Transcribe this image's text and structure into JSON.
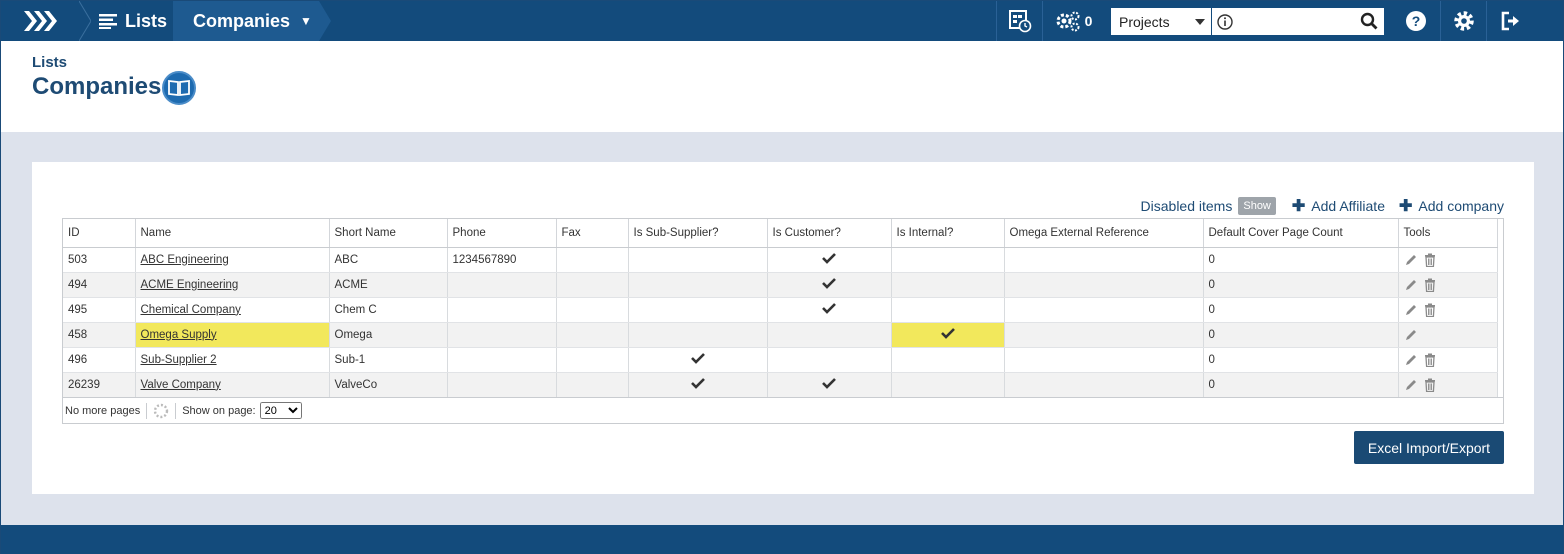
{
  "nav": {
    "lists_label": "Lists",
    "companies_label": "Companies",
    "notifications_count": "0",
    "project_select": "Projects"
  },
  "header": {
    "breadcrumb": "Lists",
    "title": "Companies"
  },
  "actions": {
    "disabled_label": "Disabled items",
    "show_badge": "Show",
    "add_affiliate": "Add Affiliate",
    "add_company": "Add company"
  },
  "table": {
    "columns": [
      "ID",
      "Name",
      "Short Name",
      "Phone",
      "Fax",
      "Is Sub-Supplier?",
      "Is Customer?",
      "Is Internal?",
      "Omega External Reference",
      "Default Cover Page Count",
      "Tools"
    ],
    "rows": [
      {
        "id": "503",
        "name": "ABC Engineering",
        "short": "ABC",
        "phone": "1234567890",
        "fax": "",
        "sub": false,
        "cust": true,
        "internal": false,
        "ext": "",
        "cover": "0",
        "delete": true
      },
      {
        "id": "494",
        "name": "ACME Engineering",
        "short": "ACME",
        "phone": "",
        "fax": "",
        "sub": false,
        "cust": true,
        "internal": false,
        "ext": "",
        "cover": "0",
        "delete": true
      },
      {
        "id": "495",
        "name": "Chemical Company",
        "short": "Chem C",
        "phone": "",
        "fax": "",
        "sub": false,
        "cust": true,
        "internal": false,
        "ext": "",
        "cover": "0",
        "delete": true
      },
      {
        "id": "458",
        "name": "Omega Supply",
        "short": "Omega",
        "phone": "",
        "fax": "",
        "sub": false,
        "cust": false,
        "internal": true,
        "ext": "",
        "cover": "0",
        "delete": false
      },
      {
        "id": "496",
        "name": "Sub-Supplier 2",
        "short": "Sub-1",
        "phone": "",
        "fax": "",
        "sub": true,
        "cust": false,
        "internal": false,
        "ext": "",
        "cover": "0",
        "delete": true
      },
      {
        "id": "26239",
        "name": "Valve Company",
        "short": "ValveCo",
        "phone": "",
        "fax": "",
        "sub": true,
        "cust": true,
        "internal": false,
        "ext": "",
        "cover": "0",
        "delete": true
      }
    ]
  },
  "pager": {
    "no_more": "No more pages",
    "show_on_page": "Show on page:",
    "page_size": "20"
  },
  "buttons": {
    "excel": "Excel Import/Export"
  },
  "colors": {
    "brand": "#134b7c",
    "highlight": "#f2e85c"
  }
}
